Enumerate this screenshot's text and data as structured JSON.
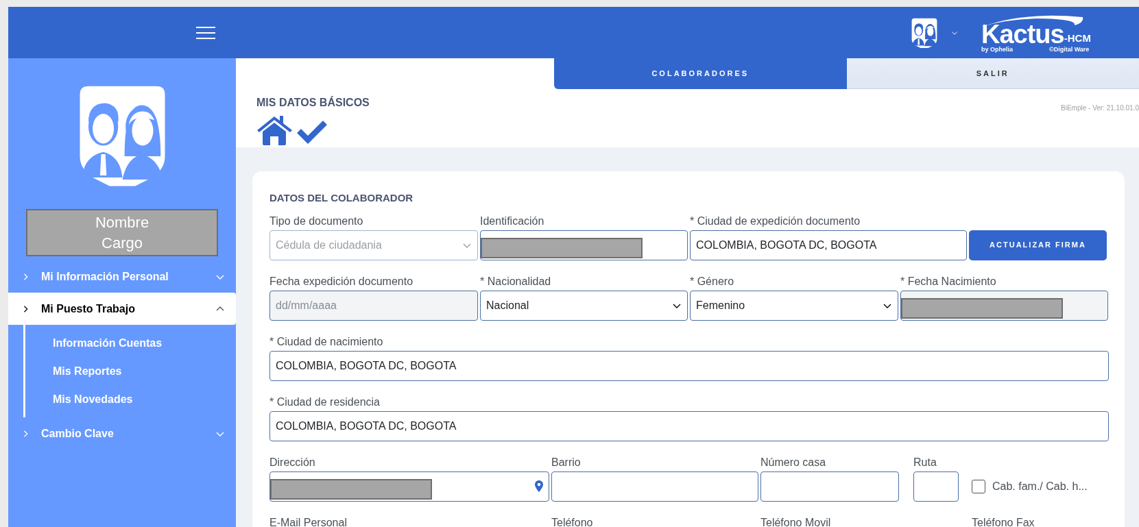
{
  "header": {
    "logo": {
      "name": "Kactus",
      "suffix": "-HCM",
      "by": "by Ophelia",
      "copyright": "©Digital Ware"
    }
  },
  "sidebar": {
    "profile": {
      "name": "Nombre",
      "position": "Cargo"
    },
    "menu": [
      {
        "label": "Mi Información Personal",
        "selected": false,
        "expanded": false
      },
      {
        "label": "Mi Puesto Trabajo",
        "selected": true,
        "expanded": true,
        "children": [
          {
            "label": "Información Cuentas"
          },
          {
            "label": "Mis Reportes"
          },
          {
            "label": "Mis Novedades"
          }
        ]
      },
      {
        "label": "Cambio Clave",
        "selected": false,
        "expanded": false
      }
    ]
  },
  "tabs": [
    {
      "label": "COLABORADORES",
      "selected": true
    },
    {
      "label": "SALIR",
      "selected": false
    }
  ],
  "page": {
    "title": "MIS DATOS BÁSICOS",
    "version": "BiEmple - Ver: 21.10.01.0"
  },
  "section": {
    "title": "DATOS DEL COLABORADOR",
    "rows": [
      [
        {
          "kind": "select",
          "label": "Tipo de documento",
          "value": "Cédula de ciudadania",
          "disabled": true
        },
        {
          "kind": "input",
          "label": "Identificación",
          "redacted": true
        },
        {
          "kind": "input",
          "label": "* Ciudad de expedición documento",
          "value": "COLOMBIA, BOGOTA DC, BOGOTA"
        },
        {
          "kind": "button",
          "label": "ACTUALIZAR FIRMA"
        }
      ],
      [
        {
          "kind": "input",
          "label": "Fecha expedición documento",
          "placeholder": "dd/mm/aaaa",
          "disabled": true
        },
        {
          "kind": "select",
          "label": "* Nacionalidad",
          "value": "Nacional",
          "disabled": false
        },
        {
          "kind": "select",
          "label": "* Género",
          "value": "Femenino",
          "disabled": false
        },
        {
          "kind": "input",
          "label": "* Fecha Nacimiento",
          "redacted": true,
          "disabled": true
        }
      ],
      [
        {
          "kind": "input",
          "label": "* Ciudad de nacimiento",
          "value": "COLOMBIA, BOGOTA DC, BOGOTA"
        }
      ],
      [
        {
          "kind": "input",
          "label": "* Ciudad de residencia",
          "value": "COLOMBIA, BOGOTA DC, BOGOTA"
        }
      ],
      [
        {
          "kind": "address",
          "label": "Dirección",
          "redacted": true
        },
        {
          "kind": "input",
          "label": "Barrio"
        },
        {
          "kind": "input",
          "label": "Número casa"
        },
        {
          "kind": "input",
          "label": "Ruta"
        },
        {
          "kind": "checkbox",
          "label": "Cab. fam./ Cab. h...",
          "checked": false
        }
      ],
      [
        {
          "kind": "label",
          "label": "E-Mail Personal"
        },
        {
          "kind": "label",
          "label": "Teléfono"
        },
        {
          "kind": "label",
          "label": "Teléfono Movil"
        },
        {
          "kind": "label",
          "label": "Teléfono Fax"
        }
      ]
    ]
  }
}
